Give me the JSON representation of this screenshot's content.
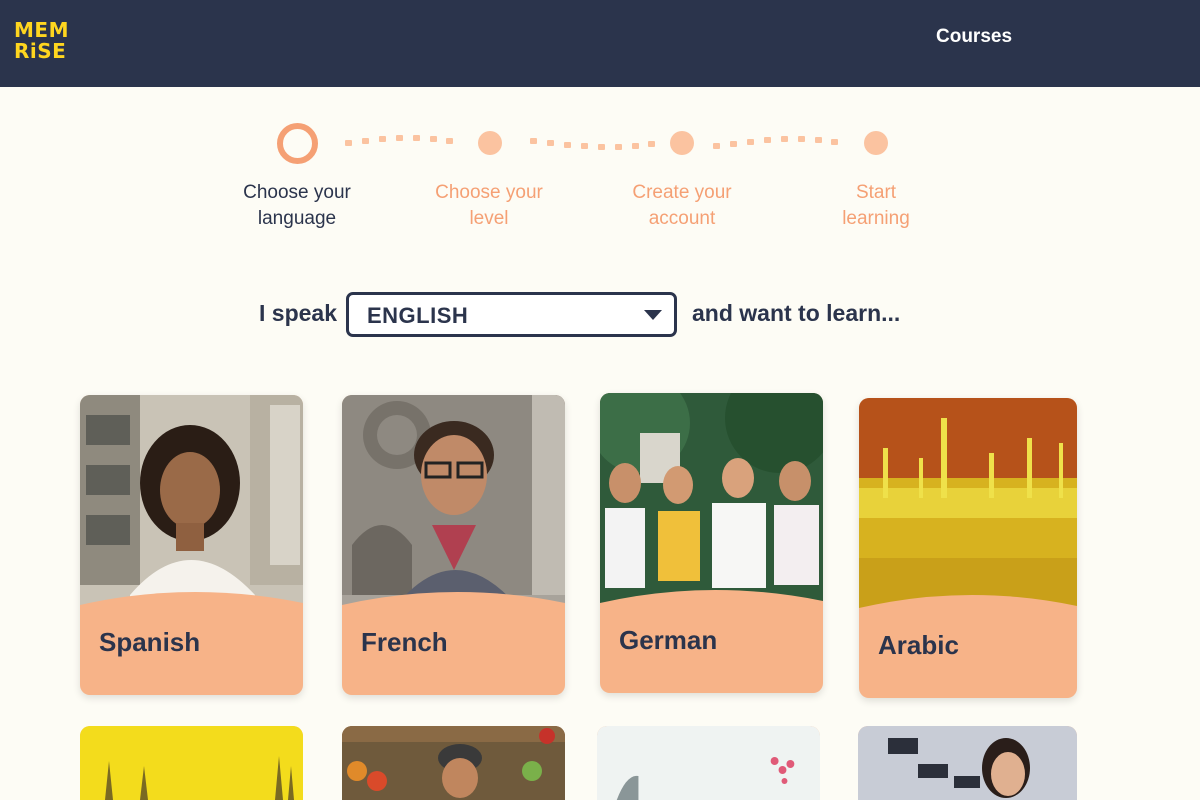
{
  "header": {
    "logo_line1": "MEM",
    "logo_line2": "RiSE",
    "nav_courses": "Courses"
  },
  "stepper": {
    "steps": [
      {
        "line1": "Choose your",
        "line2": "language",
        "state": "active"
      },
      {
        "line1": "Choose your",
        "line2": "level",
        "state": "inactive"
      },
      {
        "line1": "Create your",
        "line2": "account",
        "state": "inactive"
      },
      {
        "line1": "Start",
        "line2": "learning",
        "state": "inactive"
      }
    ]
  },
  "language_picker": {
    "prefix": "I speak",
    "selected": "ENGLISH",
    "suffix": "and want to learn..."
  },
  "courses": [
    {
      "title": "Spanish"
    },
    {
      "title": "French"
    },
    {
      "title": "German"
    },
    {
      "title": "Arabic"
    }
  ],
  "colors": {
    "header_bg": "#2b344c",
    "logo_yellow": "#ffd61f",
    "accent_orange": "#f5a074",
    "card_peach": "#f7b388",
    "page_bg": "#fdfcf5"
  }
}
